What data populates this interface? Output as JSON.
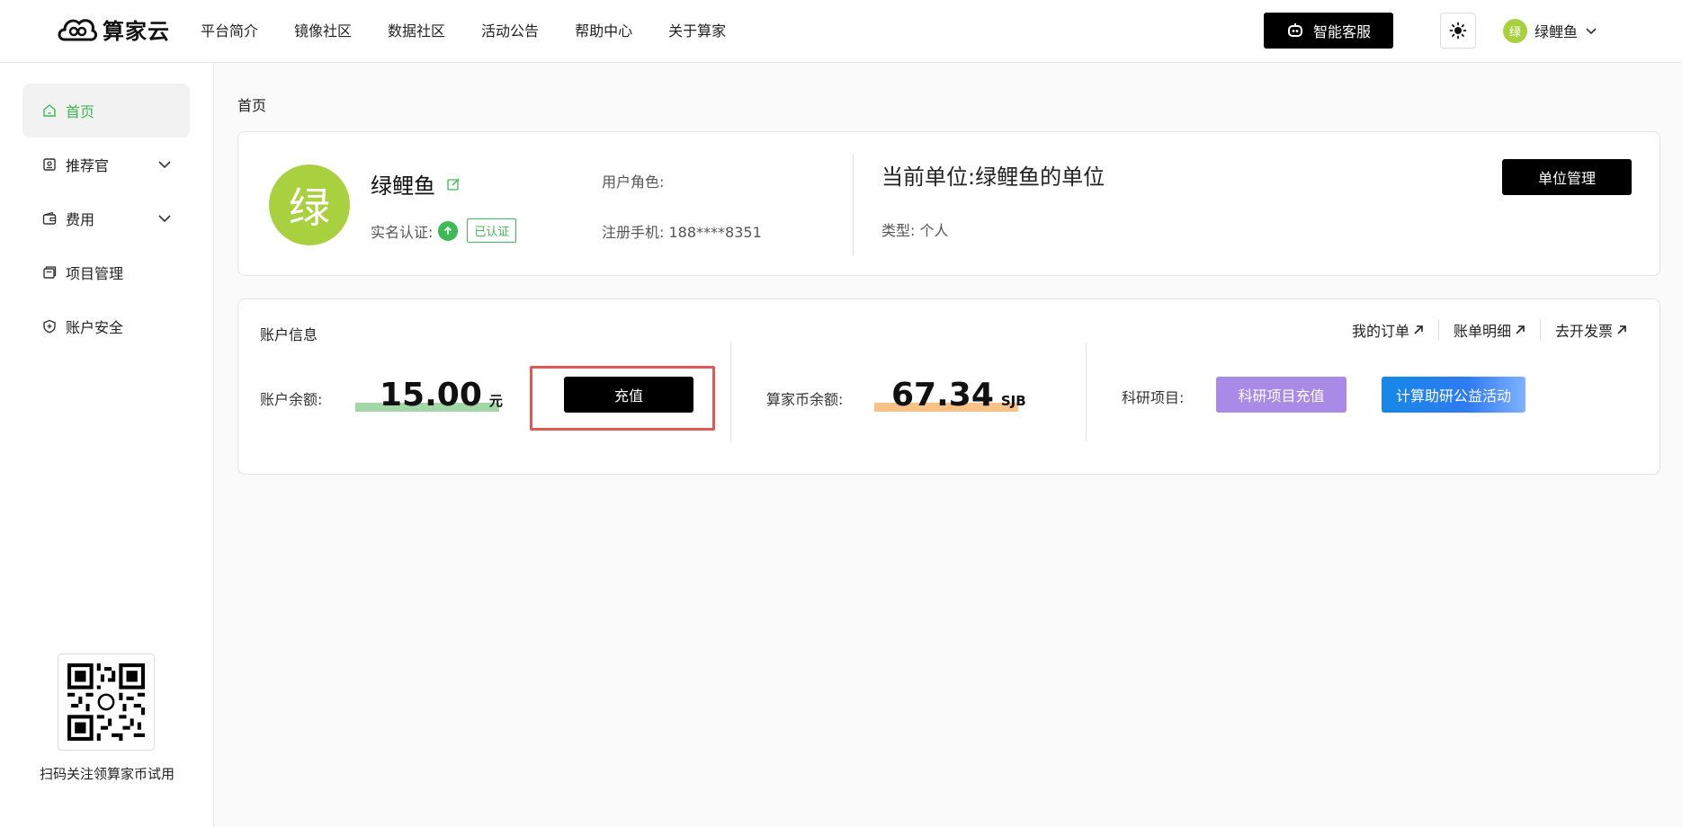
{
  "header": {
    "logo_text": "算家云",
    "nav": [
      "平台简介",
      "镜像社区",
      "数据社区",
      "活动公告",
      "帮助中心",
      "关于算家"
    ],
    "service_label": "智能客服",
    "user": {
      "avatar_char": "绿",
      "name": "绿鲤鱼"
    }
  },
  "sidebar": {
    "items": [
      {
        "label": "首页",
        "icon": "home-icon",
        "active": true
      },
      {
        "label": "推荐官",
        "icon": "badge-icon",
        "expandable": true
      },
      {
        "label": "费用",
        "icon": "wallet-icon",
        "expandable": true
      },
      {
        "label": "项目管理",
        "icon": "folder-icon"
      },
      {
        "label": "账户安全",
        "icon": "shield-icon"
      }
    ],
    "qr_caption": "扫码关注领算家币试用"
  },
  "breadcrumb": "首页",
  "profile": {
    "avatar_char": "绿",
    "name": "绿鲤鱼",
    "verify_label": "实名认证:",
    "verify_badge": "已认证",
    "role_label": "用户角色:",
    "phone_label": "注册手机:",
    "phone": "188****8351",
    "unit_label": "当前单位:",
    "unit_name": "绿鲤鱼的单位",
    "unit_type_label": "类型:",
    "unit_type": "个人",
    "unit_button": "单位管理"
  },
  "account": {
    "title": "账户信息",
    "links": [
      "我的订单",
      "账单明细",
      "去开发票"
    ],
    "balance_label": "账户余额:",
    "balance": "15.00",
    "balance_unit": "元",
    "recharge_button": "充值",
    "coin_label": "算家币余额:",
    "coin": "67.34",
    "coin_unit": "SJB",
    "research_label": "科研项目:",
    "research_button": "科研项目充值",
    "compute_button": "计算助研公益活动"
  },
  "colors": {
    "accent_green": "#3cba55",
    "avatar_green": "#a9d13f",
    "highlight_red": "#e25656",
    "balance_highlight": "#a3d6a8",
    "coin_highlight": "#f6c287",
    "research_purple": "#a98ae6",
    "compute_blue": "#1688e6"
  }
}
